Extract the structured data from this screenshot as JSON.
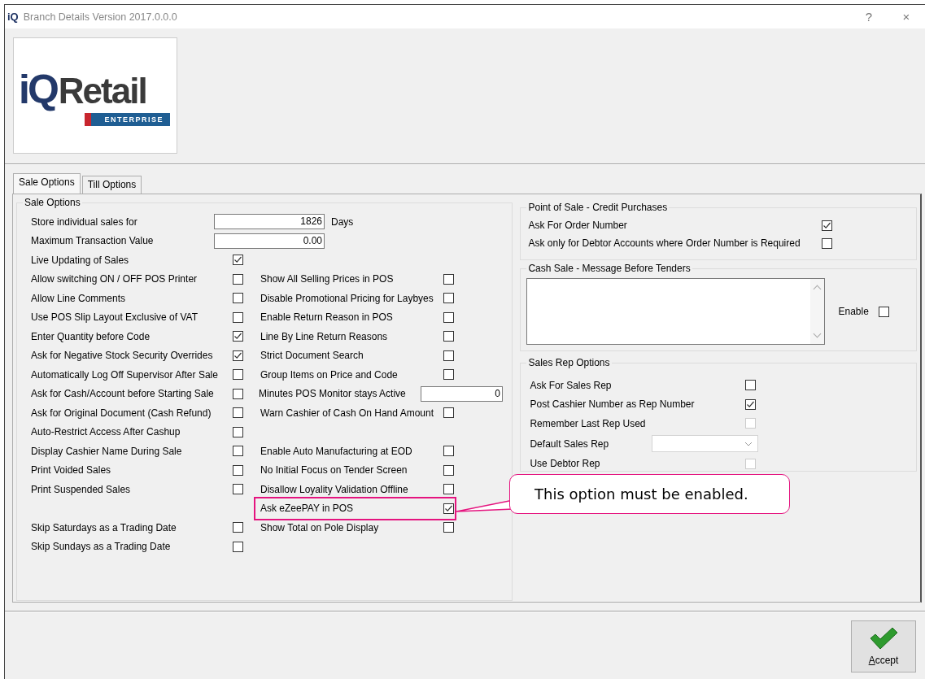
{
  "window": {
    "icon_text": "iQ",
    "title": "Branch Details Version 2017.0.0.0",
    "help_button": "?",
    "close_button": "×"
  },
  "logo": {
    "mark": "iQ",
    "name": "Retail",
    "badge": "ENTERPRISE"
  },
  "tabs": [
    {
      "label": "Sale Options",
      "selected": true
    },
    {
      "label": "Till Options",
      "selected": false
    }
  ],
  "sale_options": {
    "title": "Sale Options",
    "fields": [
      {
        "label": "Store individual sales for",
        "value": "1826",
        "unit": "Days"
      },
      {
        "label": "Maximum Transaction Value",
        "value": "0.00"
      }
    ],
    "columns": [
      {
        "groups": [
          [
            {
              "kind": "checkbox",
              "label": "Live Updating of Sales",
              "checked": true,
              "highlighted": false
            },
            {
              "kind": "checkbox",
              "label": "Allow switching ON / OFF POS Printer",
              "checked": false,
              "highlighted": false
            },
            {
              "kind": "checkbox",
              "label": "Allow Line Comments",
              "checked": false,
              "highlighted": false
            },
            {
              "kind": "checkbox",
              "label": "Use POS Slip Layout Exclusive of VAT",
              "checked": false,
              "highlighted": false
            },
            {
              "kind": "checkbox",
              "label": "Enter Quantity before Code",
              "checked": true,
              "highlighted": false
            },
            {
              "kind": "checkbox",
              "label": "Ask for Negative Stock Security Overrides",
              "checked": true,
              "highlighted": false
            },
            {
              "kind": "checkbox",
              "label": "Automatically Log Off Supervisor After Sale",
              "checked": false,
              "highlighted": false
            },
            {
              "kind": "checkbox",
              "label": "Ask for Cash/Account before Starting Sale",
              "checked": false,
              "highlighted": false
            },
            {
              "kind": "checkbox",
              "label": "Ask for Original Document (Cash Refund)",
              "checked": false,
              "highlighted": false
            },
            {
              "kind": "checkbox",
              "label": "Auto-Restrict Access After Cashup",
              "checked": false,
              "highlighted": false
            },
            {
              "kind": "checkbox",
              "label": "Display Cashier Name During Sale",
              "checked": false,
              "highlighted": false
            },
            {
              "kind": "checkbox",
              "label": "Print Voided Sales",
              "checked": false,
              "highlighted": false
            },
            {
              "kind": "checkbox",
              "label": "Print Suspended Sales",
              "checked": false,
              "highlighted": false
            }
          ],
          [
            {
              "kind": "checkbox",
              "label": "Skip Saturdays as a Trading Date",
              "checked": false,
              "highlighted": false
            },
            {
              "kind": "checkbox",
              "label": "Skip Sundays as a Trading Date",
              "checked": false,
              "highlighted": false
            }
          ]
        ]
      },
      {
        "groups": [
          [
            {
              "kind": "checkbox",
              "label": "Show All Selling Prices in POS",
              "checked": false,
              "highlighted": false
            },
            {
              "kind": "checkbox",
              "label": "Disable Promotional Pricing for Laybyes",
              "checked": false,
              "highlighted": false
            },
            {
              "kind": "checkbox",
              "label": "Enable Return Reason in POS",
              "checked": false,
              "highlighted": false
            },
            {
              "kind": "checkbox",
              "label": "Line By Line Return Reasons",
              "checked": false,
              "highlighted": false
            },
            {
              "kind": "checkbox",
              "label": "Strict Document Search",
              "checked": false,
              "highlighted": false
            },
            {
              "kind": "checkbox",
              "label": "Group Items on Price and Code",
              "checked": false,
              "highlighted": false
            },
            {
              "kind": "number",
              "label": "Minutes POS Monitor stays Active",
              "value": "0",
              "highlighted": false
            },
            {
              "kind": "checkbox",
              "label": "Warn Cashier of Cash On Hand Amount",
              "checked": false,
              "highlighted": false
            }
          ],
          [
            {
              "kind": "checkbox",
              "label": "Enable Auto Manufacturing at EOD",
              "checked": false,
              "highlighted": false
            },
            {
              "kind": "checkbox",
              "label": "No Initial Focus on Tender Screen",
              "checked": false,
              "highlighted": false
            },
            {
              "kind": "checkbox",
              "label": "Disallow Loyality Validation Offline",
              "checked": false,
              "highlighted": false
            },
            {
              "kind": "checkbox",
              "label": "Ask eZeePAY in POS",
              "checked": true,
              "highlighted": true
            },
            {
              "kind": "checkbox",
              "label": "Show Total on Pole Display",
              "checked": false,
              "highlighted": false
            }
          ]
        ]
      }
    ]
  },
  "credit_purchases": {
    "title": "Point of Sale - Credit Purchases",
    "items": [
      {
        "label": "Ask For Order Number",
        "checked": true
      },
      {
        "label": "Ask only for Debtor Accounts where Order Number is Required",
        "checked": false
      }
    ]
  },
  "cash_sale_message": {
    "title": "Cash Sale - Message Before Tenders",
    "enable_label": "Enable",
    "enable_checked": false
  },
  "sales_rep": {
    "title": "Sales Rep Options",
    "items": [
      {
        "kind": "checkbox",
        "label": "Ask For Sales Rep",
        "checked": false,
        "disabled": false
      },
      {
        "kind": "checkbox",
        "label": "Post Cashier Number as Rep Number",
        "checked": true,
        "disabled": false
      },
      {
        "kind": "checkbox",
        "label": "Remember Last Rep Used",
        "checked": false,
        "disabled": true
      },
      {
        "kind": "dropdown",
        "label": "Default Sales Rep",
        "disabled": false
      },
      {
        "kind": "checkbox",
        "label": "Use Debtor Rep",
        "checked": false,
        "disabled": true
      }
    ]
  },
  "callout": {
    "text": "This option must be enabled."
  },
  "accept_button": {
    "label": "Accept"
  }
}
